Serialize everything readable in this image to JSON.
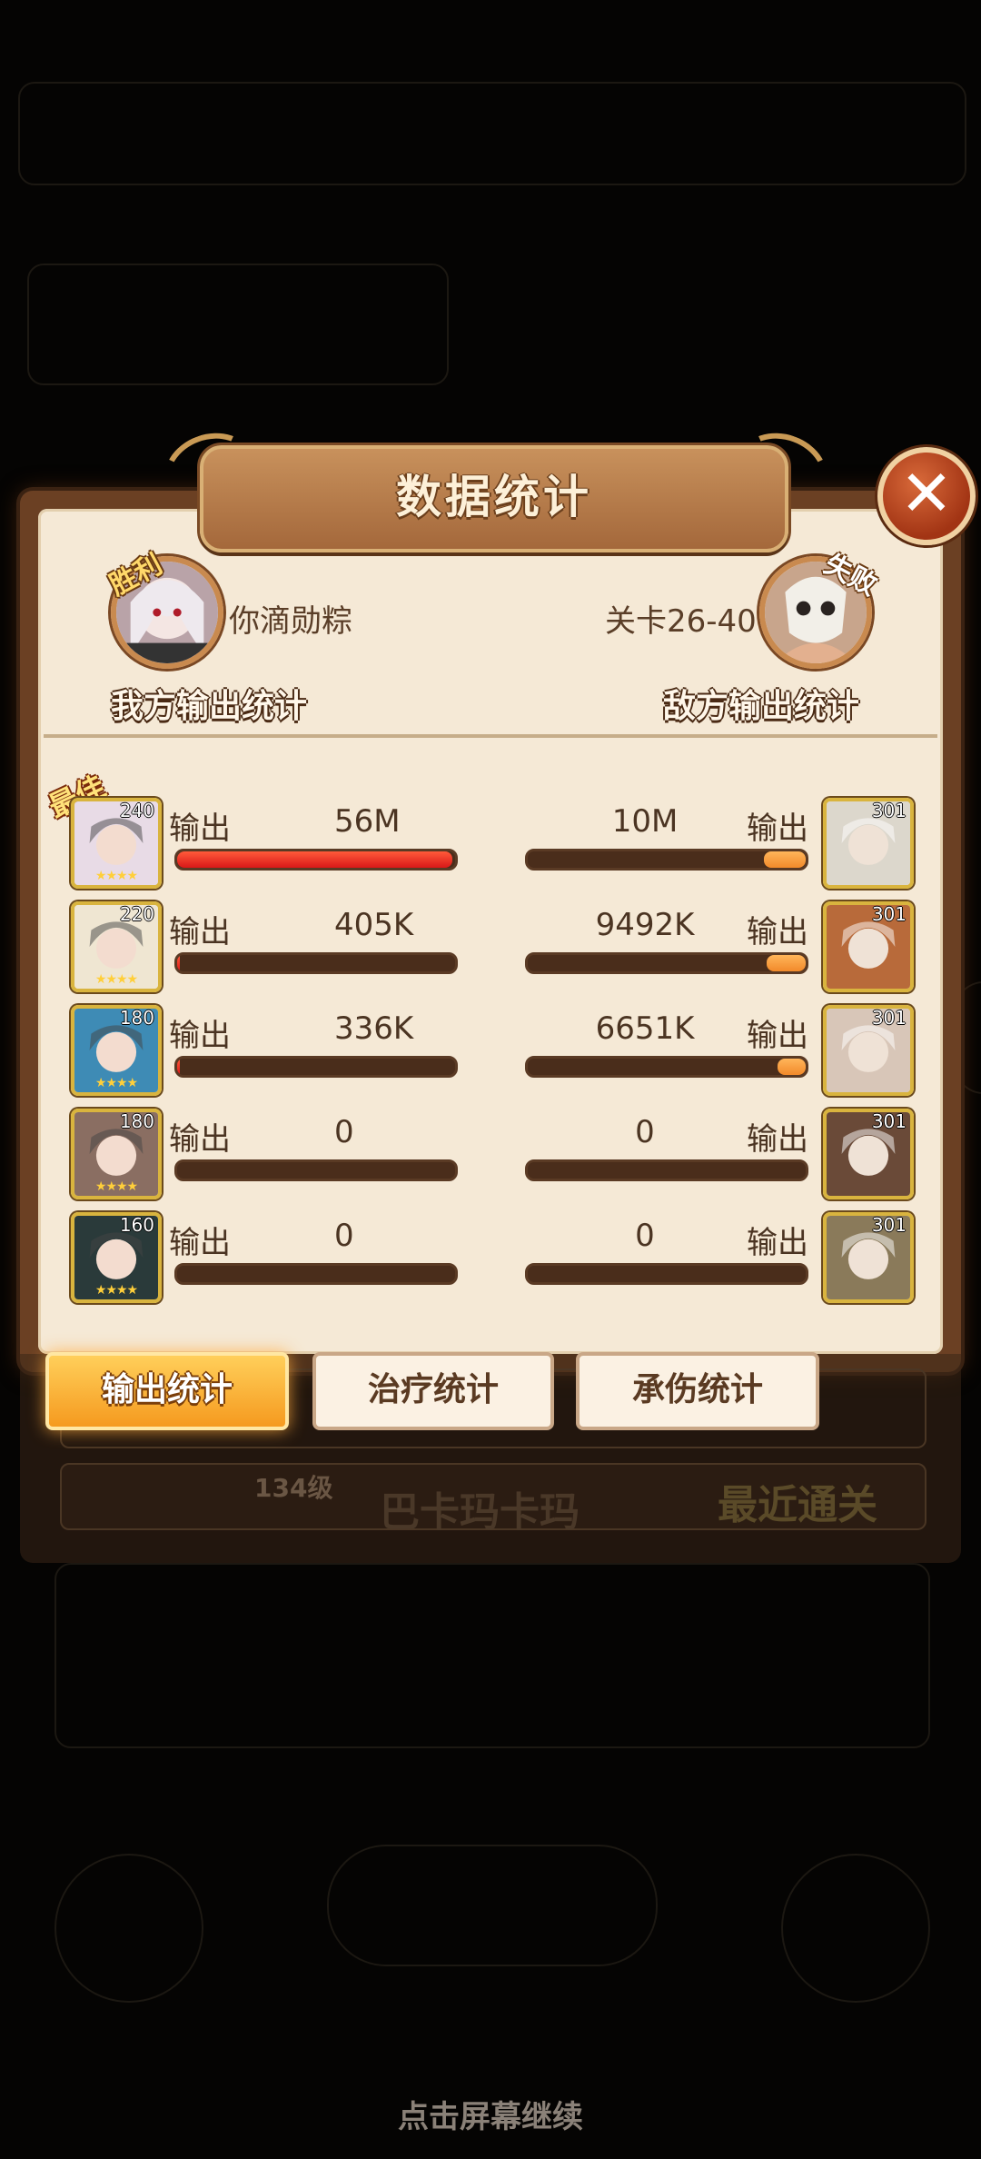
{
  "dialog": {
    "title": "数据统计",
    "close_icon": "close-icon"
  },
  "header": {
    "left_stamp": "胜利",
    "player_name": "你滴勋粽",
    "right_stamp": "失败",
    "stage": "关卡26-40",
    "our_title": "我方输出统计",
    "enemy_title": "敌方输出统计"
  },
  "best_badge": "最佳",
  "output_label": "输出",
  "rows": [
    {
      "left_level": "240",
      "left_value": "56M",
      "left_fill": 0.99,
      "right_value": "10M",
      "right_fill": 0.15,
      "right_level": "301"
    },
    {
      "left_level": "220",
      "left_value": "405K",
      "left_fill": 0.01,
      "right_value": "9492K",
      "right_fill": 0.14,
      "right_level": "301"
    },
    {
      "left_level": "180",
      "left_value": "336K",
      "left_fill": 0.01,
      "right_value": "6651K",
      "right_fill": 0.1,
      "right_level": "301"
    },
    {
      "left_level": "180",
      "left_value": "0",
      "left_fill": 0,
      "right_value": "0",
      "right_fill": 0,
      "right_level": "301"
    },
    {
      "left_level": "160",
      "left_value": "0",
      "left_fill": 0,
      "right_value": "0",
      "right_fill": 0,
      "right_level": "301"
    }
  ],
  "tabs": [
    {
      "label": "输出统计",
      "active": true
    },
    {
      "label": "治疗统计",
      "active": false
    },
    {
      "label": "承伤统计",
      "active": false
    }
  ],
  "background": {
    "level_text": "134级",
    "name_text": "巴卡玛卡玛",
    "ribbon_text": "最近通关"
  },
  "footer": {
    "continue_text": "点击屏幕继续"
  },
  "colors": {
    "panel": "#f5e9d6",
    "frame": "#6b4023",
    "bar_track": "#4a2d1b",
    "bar_ours": "#e02a1e",
    "bar_enemy": "#f28a2a",
    "tab_active": "#f59a1f"
  }
}
